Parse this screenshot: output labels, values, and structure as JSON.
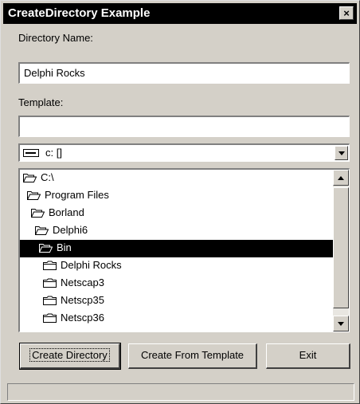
{
  "window": {
    "title": "CreateDirectory Example",
    "close_glyph": "×"
  },
  "directory_name": {
    "label": "Directory Name:",
    "value": "Delphi Rocks"
  },
  "template": {
    "label": "Template:",
    "value": ""
  },
  "drive": {
    "value": "c: []",
    "icon": "drive-icon"
  },
  "tree": {
    "items": [
      {
        "label": "C:\\",
        "level": 0,
        "selected": false,
        "open": true
      },
      {
        "label": "Program Files",
        "level": 1,
        "selected": false,
        "open": true
      },
      {
        "label": "Borland",
        "level": 2,
        "selected": false,
        "open": true
      },
      {
        "label": "Delphi6",
        "level": 3,
        "selected": false,
        "open": true
      },
      {
        "label": "Bin",
        "level": 4,
        "selected": true,
        "open": true
      },
      {
        "label": "Delphi Rocks",
        "level": 5,
        "selected": false,
        "open": false
      },
      {
        "label": "Netscap3",
        "level": 5,
        "selected": false,
        "open": false
      },
      {
        "label": "Netscp35",
        "level": 5,
        "selected": false,
        "open": false
      },
      {
        "label": "Netscp36",
        "level": 5,
        "selected": false,
        "open": false
      }
    ]
  },
  "buttons": {
    "create_directory": "Create Directory",
    "create_from_template": "Create From Template",
    "exit": "Exit"
  },
  "status": {
    "text": ""
  }
}
